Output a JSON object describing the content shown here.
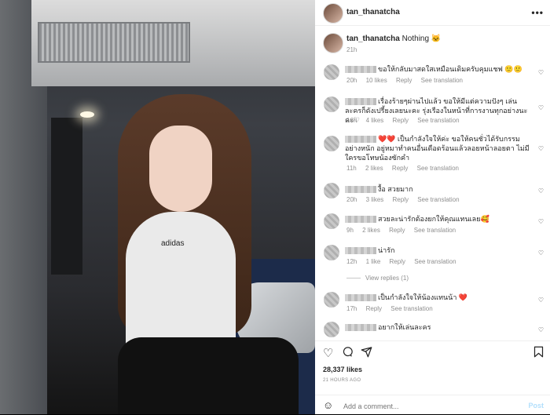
{
  "post": {
    "username": "tan_thanatcha",
    "caption": "Nothing 🐱",
    "caption_time": "21h",
    "likes": "28,337 likes",
    "posted_ago": "21 HOURS AGO",
    "shirt_logo": "adidas"
  },
  "comments": [
    {
      "text": "ขอให้กลับมาสดใสเหมือนเดิมครับคุมแชฟ 🙂🙂",
      "time": "20h",
      "likes": "10 likes",
      "reply": "Reply",
      "translate": "See translation"
    },
    {
      "text": "เรื่องร้ายๆผ่านไปแล้ว ขอให้มีแต่ความปังๆ เล่นละครก็ดังเปรี้ยงเลยนะคะ รุ่งเรืองในหน้าที่การงานทุกอย่างนะคะ♡",
      "time": "16h",
      "likes": "4 likes",
      "reply": "Reply",
      "translate": "See translation"
    },
    {
      "text": "❤️❤️ เป็นกำลังใจให้ค่ะ ขอให้คนชั่วได้รับกรรมอย่างหนัก อยู่หมาทำคนอื่นเดือดร้อนแล้วลอยหน้าลอยตา ไม่มีใครขอโทษน้องซักคำ",
      "time": "11h",
      "likes": "2 likes",
      "reply": "Reply",
      "translate": "See translation"
    },
    {
      "text": "งื้อ สวยมาก",
      "time": "20h",
      "likes": "3 likes",
      "reply": "Reply",
      "translate": "See translation"
    },
    {
      "text": "สวยละน่ารักต้องยกให้คุณแทนเลย🥰",
      "time": "9h",
      "likes": "2 likes",
      "reply": "Reply",
      "translate": "See translation"
    },
    {
      "text": "น่ารัก",
      "time": "12h",
      "likes": "1 like",
      "reply": "Reply",
      "translate": "See translation"
    },
    {
      "text": "เป็นกำลังใจให้น้องแทนน้า ❤️",
      "time": "17h",
      "likes": "",
      "reply": "Reply",
      "translate": "See translation"
    },
    {
      "text": "อยากให้เล่นละคร",
      "time": "",
      "likes": "",
      "reply": "",
      "translate": ""
    }
  ],
  "view_replies": "View replies (1)",
  "add_comment": {
    "placeholder": "Add a comment...",
    "post_label": "Post"
  },
  "icons": {
    "more": "more-icon",
    "heart": "heart-icon",
    "comment": "comment-icon",
    "share": "share-icon",
    "bookmark": "bookmark-icon",
    "emoji": "emoji-icon"
  }
}
